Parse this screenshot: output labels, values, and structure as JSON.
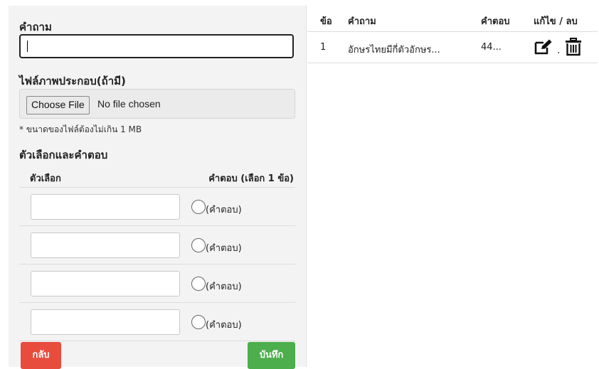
{
  "form": {
    "question_label": "คำถาม",
    "question_value": "",
    "image_label": "ไฟล์ภาพประกอบ(ถ้ามี)",
    "file_button": "Choose File",
    "file_status": "No file chosen",
    "file_note": "* ขนาดของไฟล์ต้องไม่เกิน 1 MB",
    "options_title": "ตัวเลือกและคำตอบ",
    "options_header_choice": "ตัวเลือก",
    "options_header_answer": "คำตอบ (เลือก 1 ข้อ)",
    "options": [
      {
        "value": "",
        "radio_label": "(คำตอบ)"
      },
      {
        "value": "",
        "radio_label": "(คำตอบ)"
      },
      {
        "value": "",
        "radio_label": "(คำตอบ)"
      },
      {
        "value": "",
        "radio_label": "(คำตอบ)"
      }
    ],
    "back_button": "กลับ",
    "save_button": "บันทึก"
  },
  "table": {
    "headers": {
      "no": "ข้อ",
      "question": "คำถาม",
      "answer": "คำตอบ",
      "actions": "แก้ไข / ลบ"
    },
    "rows": [
      {
        "no": "1",
        "question": "อักษรไทยมีกี่ตัวอักษร...",
        "answer": "44..."
      }
    ]
  },
  "colors": {
    "back": "#e84c3d",
    "save": "#4cae4c"
  },
  "icons": {
    "edit": "edit-icon",
    "delete": "trash-icon"
  }
}
